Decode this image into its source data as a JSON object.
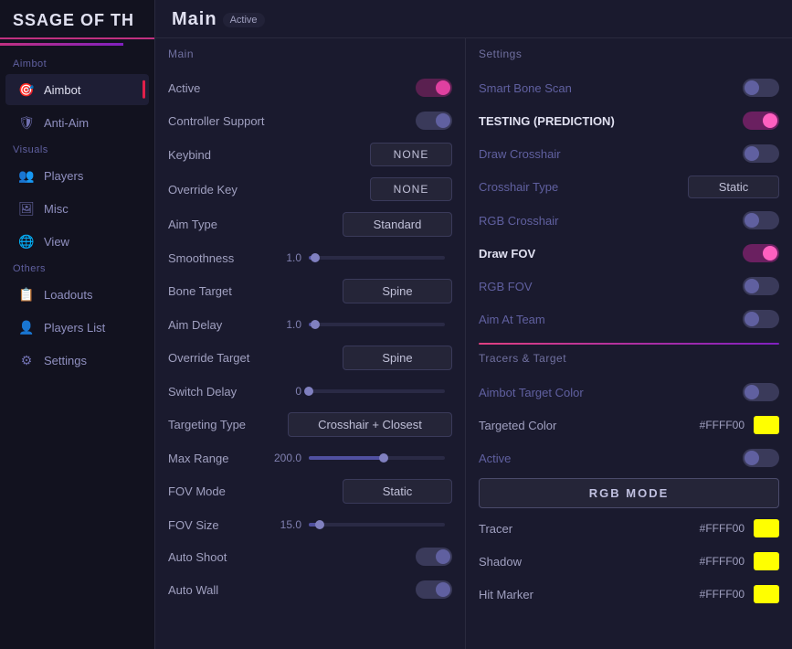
{
  "sidebar": {
    "header": "SSAGE OF TH",
    "sections": [
      {
        "label": "Aimbot",
        "items": [
          {
            "id": "aimbot",
            "label": "Aimbot",
            "icon": "🎯",
            "active": true
          },
          {
            "id": "anti-aim",
            "label": "Anti-Aim",
            "icon": "🛡"
          }
        ]
      },
      {
        "label": "Visuals",
        "items": [
          {
            "id": "players",
            "label": "Players",
            "icon": "👥"
          },
          {
            "id": "misc",
            "label": "Misc",
            "icon": "🖼"
          },
          {
            "id": "view",
            "label": "View",
            "icon": "🌐"
          }
        ]
      },
      {
        "label": "Others",
        "items": [
          {
            "id": "loadouts",
            "label": "Loadouts",
            "icon": "📋"
          },
          {
            "id": "players-list",
            "label": "Players List",
            "icon": "👤"
          },
          {
            "id": "settings",
            "label": "Settings",
            "icon": "⚙"
          }
        ]
      }
    ]
  },
  "main": {
    "title": "Main",
    "badge": "Active"
  },
  "left_panel": {
    "section": "Main",
    "settings": [
      {
        "id": "active",
        "label": "Active",
        "type": "toggle",
        "state": "on-active"
      },
      {
        "id": "controller-support",
        "label": "Controller Support",
        "type": "toggle",
        "state": "on"
      },
      {
        "id": "keybind",
        "label": "Keybind",
        "type": "keybind",
        "value": "NONE"
      },
      {
        "id": "override-key",
        "label": "Override Key",
        "type": "keybind",
        "value": "NONE"
      },
      {
        "id": "aim-type",
        "label": "Aim Type",
        "type": "dropdown",
        "value": "Standard"
      },
      {
        "id": "smoothness",
        "label": "Smoothness",
        "type": "slider",
        "value": "1.0",
        "percent": 5
      },
      {
        "id": "bone-target",
        "label": "Bone Target",
        "type": "dropdown",
        "value": "Spine"
      },
      {
        "id": "aim-delay",
        "label": "Aim Delay",
        "type": "slider",
        "value": "1.0",
        "percent": 5
      },
      {
        "id": "override-target",
        "label": "Override Target",
        "type": "dropdown",
        "value": "Spine"
      },
      {
        "id": "switch-delay",
        "label": "Switch Delay",
        "type": "slider",
        "value": "0",
        "percent": 0
      },
      {
        "id": "targeting-type",
        "label": "Targeting Type",
        "type": "dropdown",
        "value": "Crosshair + Closest",
        "wide": true
      },
      {
        "id": "max-range",
        "label": "Max Range",
        "type": "slider",
        "value": "200.0",
        "percent": 55
      },
      {
        "id": "fov-mode",
        "label": "FOV Mode",
        "type": "dropdown",
        "value": "Static"
      },
      {
        "id": "fov-size",
        "label": "FOV Size",
        "type": "slider",
        "value": "15.0",
        "percent": 8
      },
      {
        "id": "auto-shoot",
        "label": "Auto Shoot",
        "type": "toggle",
        "state": "on"
      },
      {
        "id": "auto-wall",
        "label": "Auto Wall",
        "type": "toggle",
        "state": "on"
      }
    ]
  },
  "right_panel": {
    "top_section": {
      "label": "Settings",
      "settings": [
        {
          "id": "smart-bone-scan",
          "label": "Smart Bone Scan",
          "type": "toggle",
          "state": "off"
        },
        {
          "id": "testing-prediction",
          "label": "TESTING (PREDICTION)",
          "type": "toggle",
          "state": "on-bright",
          "bright": true
        },
        {
          "id": "draw-crosshair",
          "label": "Draw Crosshair",
          "type": "toggle",
          "state": "off"
        },
        {
          "id": "crosshair-type",
          "label": "Crosshair Type",
          "type": "display",
          "value": "Static"
        },
        {
          "id": "rgb-crosshair",
          "label": "RGB Crosshair",
          "type": "toggle",
          "state": "off"
        },
        {
          "id": "draw-fov",
          "label": "Draw FOV",
          "type": "toggle",
          "state": "on-bright",
          "bright": true
        },
        {
          "id": "rgb-fov",
          "label": "RGB FOV",
          "type": "toggle",
          "state": "off"
        },
        {
          "id": "aim-at-team",
          "label": "Aim At Team",
          "type": "toggle",
          "state": "off"
        }
      ]
    },
    "bottom_section": {
      "label": "Tracers & Target",
      "settings": [
        {
          "id": "aimbot-target-color",
          "label": "Aimbot Target Color",
          "type": "toggle",
          "state": "off"
        },
        {
          "id": "targeted-color",
          "label": "Targeted Color",
          "type": "color",
          "value": "#FFFF00",
          "color": "#FFFF00"
        },
        {
          "id": "active2",
          "label": "Active",
          "type": "toggle",
          "state": "off"
        },
        {
          "id": "rgb-mode",
          "label": "RGB MODE",
          "type": "rgb-btn"
        },
        {
          "id": "tracer",
          "label": "Tracer",
          "type": "color",
          "value": "#FFFF00",
          "color": "#FFFF00"
        },
        {
          "id": "shadow",
          "label": "Shadow",
          "type": "color",
          "value": "#FFFF00",
          "color": "#FFFF00"
        },
        {
          "id": "hit-marker",
          "label": "Hit Marker",
          "type": "color",
          "value": "#FFFF00",
          "color": "#FFFF00"
        }
      ]
    }
  }
}
